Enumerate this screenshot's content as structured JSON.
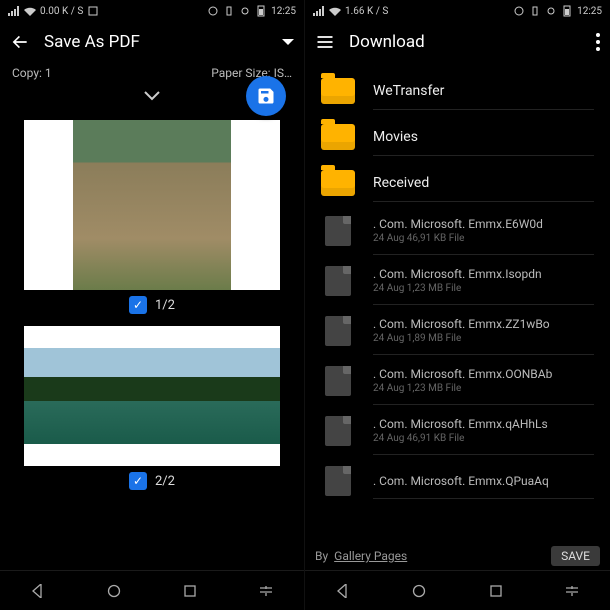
{
  "left": {
    "status": {
      "speed": "0.00 K / S",
      "time": "12:25"
    },
    "appbar": {
      "title": "Save As PDF"
    },
    "config": {
      "copy_label": "Copy:",
      "copy_value": "1",
      "paper_label": "Paper Size:",
      "paper_value": "IS…"
    },
    "pages": [
      {
        "label": "1/2",
        "checked": true
      },
      {
        "label": "2/2",
        "checked": true
      }
    ]
  },
  "right": {
    "status": {
      "speed": "1.66 K / S",
      "time": "12:25"
    },
    "appbar": {
      "title": "Download"
    },
    "folders": [
      {
        "name": "WeTransfer"
      },
      {
        "name": "Movies"
      },
      {
        "name": "Received"
      }
    ],
    "files": [
      {
        "name": ". Com. Microsoft. Emmx.E6W0d",
        "meta": "24 Aug 46,91 KB File"
      },
      {
        "name": ". Com. Microsoft. Emmx.Isopdn",
        "meta": "24 Aug 1,23 MB File"
      },
      {
        "name": ". Com. Microsoft. Emmx.ZZ1wBo",
        "meta": "24 Aug 1,89 MB File"
      },
      {
        "name": ". Com. Microsoft. Emmx.OONBAb",
        "meta": "24 Aug 1,23 MB File"
      },
      {
        "name": ". Com. Microsoft. Emmx.qAHhLs",
        "meta": "24 Aug 46,91 KB File"
      },
      {
        "name": ". Com. Microsoft. Emmx.QPuaAq",
        "meta": ""
      }
    ],
    "bottom": {
      "path_prefix": "By",
      "path_value": "Gallery Pages",
      "save": "SAVE"
    }
  },
  "colors": {
    "accent": "#1a73e8",
    "folder": "#ffb300"
  }
}
